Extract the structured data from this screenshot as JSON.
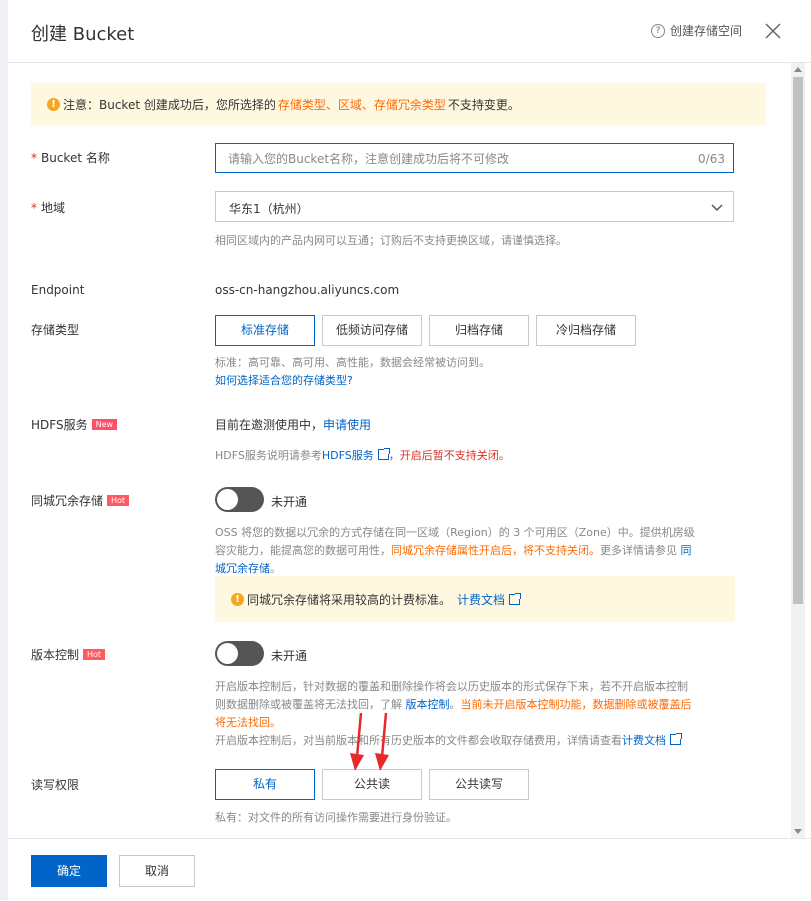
{
  "header": {
    "title": "创建 Bucket",
    "help_label": "创建存储空间"
  },
  "notice": {
    "prefix": "注意：Bucket 创建成功后，您所选择的 ",
    "highlight": "存储类型、区域、存储冗余类型",
    "suffix": " 不支持变更。"
  },
  "bucket_name": {
    "label": "Bucket 名称",
    "required": "*",
    "placeholder": "请输入您的Bucket名称，注意创建成功后将不可修改",
    "counter": "0/63"
  },
  "region": {
    "label": "地域",
    "required": "*",
    "value": "华东1（杭州）",
    "hint": "相同区域内的产品内网可以互通；订购后不支持更换区域，请谨慎选择。"
  },
  "endpoint": {
    "label": "Endpoint",
    "value": "oss-cn-hangzhou.aliyuncs.com"
  },
  "storage_class": {
    "label": "存储类型",
    "options": [
      "标准存储",
      "低频访问存储",
      "归档存储",
      "冷归档存储"
    ],
    "selected": "标准存储",
    "hint": "标准：高可靠、高可用、高性能，数据会经常被访问到。",
    "help_link": "如何选择适合您的存储类型?"
  },
  "hdfs": {
    "label": "HDFS服务",
    "badge": "New",
    "status_text": "目前在邀测使用中，",
    "apply_link": "申请使用",
    "hint_prefix": "HDFS服务说明请参考",
    "hint_link": "HDFS服务",
    "hint_warning": "，开启后暂不支持关闭。"
  },
  "zone_redundancy": {
    "label": "同城冗余存储",
    "badge": "Hot",
    "toggle_text": "未开通",
    "desc_line1": "OSS 将您的数据以冗余的方式存储在同一区域（Region）的 3 个可用区（Zone）中。提供机房级",
    "desc_line2_a": "容灾能力，能提高您的数据可用性，",
    "desc_line2_b": "同城冗余存储属性开启后，将不支持关闭。",
    "desc_line2_c": "更多详情请参见 ",
    "desc_line2_link": "同",
    "desc_line3_link": "城冗余存储",
    "desc_line3_end": "。",
    "note_text": "同城冗余存储将采用较高的计费标准。",
    "note_link": "计费文档"
  },
  "versioning": {
    "label": "版本控制",
    "badge": "Hot",
    "toggle_text": "未开通",
    "line1": "开启版本控制后，针对数据的覆盖和删除操作将会以历史版本的形式保存下来，若不开启版本控制",
    "line2_a": "则数据删除或被覆盖将无法找回，了解 ",
    "line2_link": "版本控制",
    "line2_b": "。",
    "line2_warn": "当前未开启版本控制功能，数据删除或被覆盖后",
    "line3_warn": "将无法找回。",
    "line4_a": "开启版本控制后，对当前版本和所有历史版本的文件都会收取存储费用，详情请查看",
    "line4_link": "计费文档"
  },
  "acl": {
    "label": "读写权限",
    "options": [
      "私有",
      "公共读",
      "公共读写"
    ],
    "selected": "私有",
    "hint": "私有：对文件的所有访问操作需要进行身份验证。"
  },
  "footer": {
    "confirm": "确定",
    "cancel": "取消"
  },
  "colors": {
    "primary": "#0064c8",
    "warning": "#ff6a00",
    "danger": "#d93026",
    "notice_bg": "#fff8e1"
  }
}
